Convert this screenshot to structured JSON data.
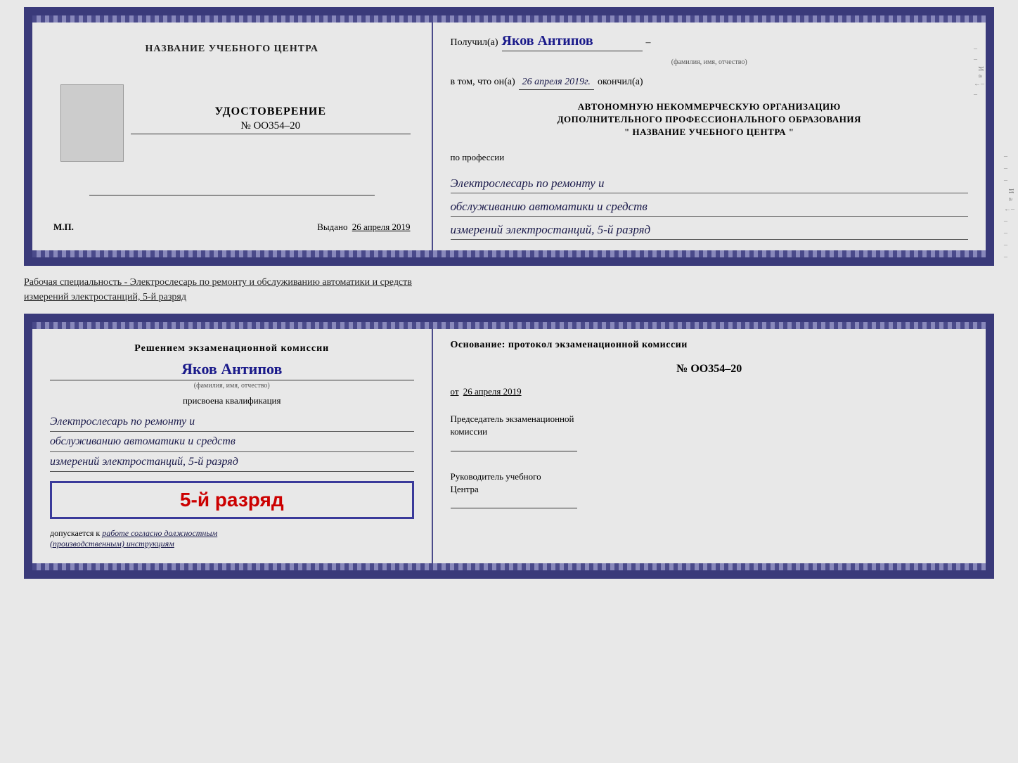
{
  "top_cert": {
    "left": {
      "training_center_label": "НАЗВАНИЕ УЧЕБНОГО ЦЕНТРА",
      "udostoverenie_title": "УДОСТОВЕРЕНИЕ",
      "number": "№ ОО354–20",
      "vydano_label": "Выдано",
      "vydano_date": "26 апреля 2019",
      "mp_label": "М.П."
    },
    "right": {
      "poluchil_label": "Получил(а)",
      "person_name": "Яков Антипов",
      "fio_subtitle": "(фамилия, имя, отчество)",
      "vtom_label": "в том, что он(а)",
      "date_handwritten": "26 апреля 2019г.",
      "okonchil_label": "окончил(а)",
      "org_line1": "АВТОНОМНУЮ НЕКОММЕРЧЕСКУЮ ОРГАНИЗАЦИЮ",
      "org_line2": "ДОПОЛНИТЕЛЬНОГО ПРОФЕССИОНАЛЬНОГО ОБРАЗОВАНИЯ",
      "org_quote_open": "\"",
      "org_name": "НАЗВАНИЕ УЧЕБНОГО ЦЕНТРА",
      "org_quote_close": "\"",
      "po_professii_label": "по профессии",
      "profession_line1": "Электрослесарь по ремонту и",
      "profession_line2": "обслуживанию автоматики и средств",
      "profession_line3": "измерений электростанций, 5-й разряд"
    }
  },
  "middle_text": "Рабочая специальность - Электрослесарь по ремонту и обслуживанию автоматики и средств\nизмерений электростанций, 5-й разряд",
  "bottom_cert": {
    "left": {
      "resheniem_label": "Решением экзаменационной комиссии",
      "person_name": "Яков Антипов",
      "fio_subtitle": "(фамилия, имя, отчество)",
      "prisvoena_label": "присвоена квалификация",
      "qual_line1": "Электрослесарь по ремонту и",
      "qual_line2": "обслуживанию автоматики и средств",
      "qual_line3": "измерений электростанций, 5-й разряд",
      "razryad_big": "5-й разряд",
      "dopuskaetsya_label": "допускается к",
      "dopuskaetsya_italic": "работе согласно должностным",
      "instrukcii_italic": "(производственным) инструкциям"
    },
    "right": {
      "osnovanie_label": "Основание: протокол экзаменационной комиссии",
      "nomer": "№ ОО354–20",
      "ot_label": "от",
      "ot_date": "26 апреля 2019",
      "predsedatel_label": "Председатель экзаменационной",
      "komissii_label": "комиссии",
      "rukovoditel_label": "Руководитель учебного",
      "centra_label": "Центра"
    }
  }
}
